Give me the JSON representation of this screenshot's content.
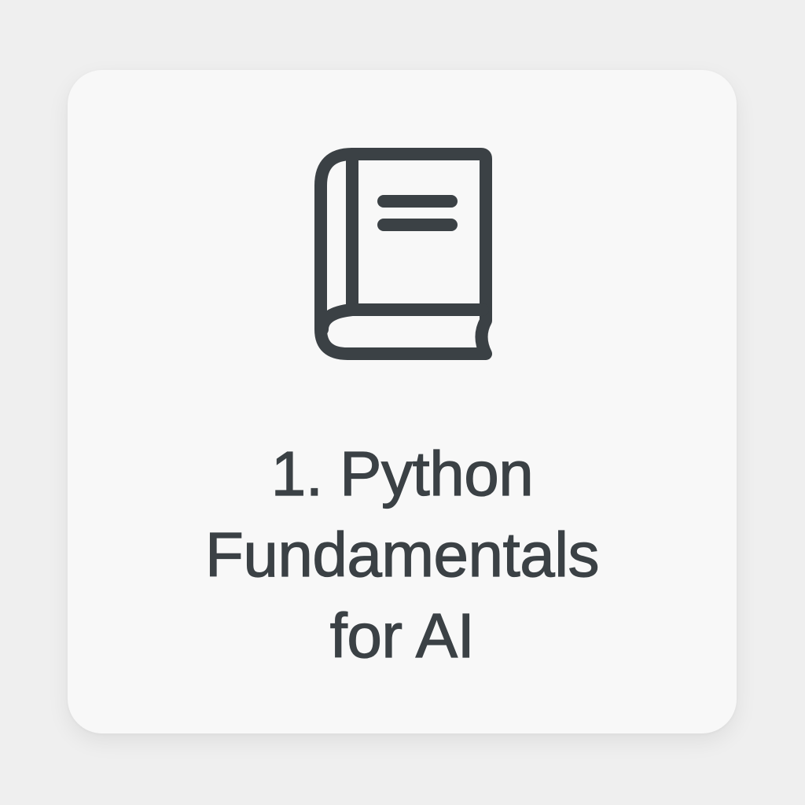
{
  "card": {
    "icon": "book-icon",
    "title_lines": [
      "1. Python",
      "Fundamentals",
      "for AI"
    ]
  },
  "colors": {
    "page_background": "#efefef",
    "card_background": "#f8f8f8",
    "ink": "#3b4145"
  }
}
